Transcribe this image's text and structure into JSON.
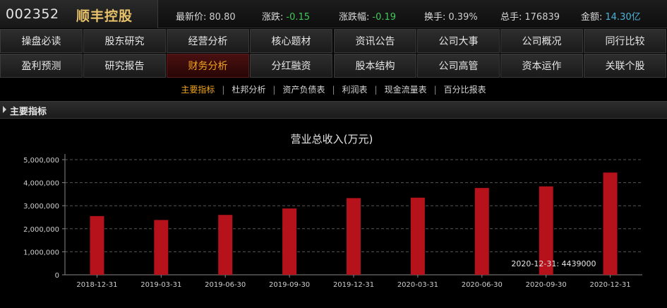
{
  "header": {
    "code": "002352",
    "name": "顺丰控股",
    "quotes": [
      {
        "label": "最新价:",
        "value": "80.80",
        "color": "#cfcfcf"
      },
      {
        "label": "涨跌:",
        "value": "-0.15",
        "color": "#41c85a"
      },
      {
        "label": "涨跌幅:",
        "value": "-0.19",
        "color": "#41c85a"
      },
      {
        "label": "换手:",
        "value": "0.39%",
        "color": "#cfcfcf"
      },
      {
        "label": "总手:",
        "value": "176839",
        "color": "#cfcfcf"
      },
      {
        "label": "金额:",
        "value": "14.30亿",
        "color": "#4fb3d9"
      }
    ]
  },
  "nav": {
    "row1": [
      "操盘必读",
      "股东研究",
      "经营分析",
      "核心题材",
      "资讯公告",
      "公司大事",
      "公司概况",
      "同行比较"
    ],
    "row2": [
      "盈利预测",
      "研究报告",
      "财务分析",
      "分红融资",
      "股本结构",
      "公司高管",
      "资本运作",
      "关联个股"
    ],
    "active": "财务分析"
  },
  "subnav": {
    "items": [
      "主要指标",
      "杜邦分析",
      "资产负债表",
      "利润表",
      "现金流量表",
      "百分比报表"
    ],
    "active": "主要指标"
  },
  "section": {
    "title": "主要指标"
  },
  "colors": {
    "bar": "#b5121b",
    "accent": "#f2a51a",
    "down": "#41c85a"
  },
  "chart_data": {
    "type": "bar",
    "title": "营业总收入(万元)",
    "categories": [
      "2018-12-31",
      "2019-03-31",
      "2019-06-30",
      "2019-09-30",
      "2019-12-31",
      "2020-03-31",
      "2020-06-30",
      "2020-09-30",
      "2020-12-31"
    ],
    "values": [
      2550000,
      2380000,
      2600000,
      2880000,
      3330000,
      3350000,
      3770000,
      3840000,
      4439000
    ],
    "ylim": [
      0,
      5000000
    ],
    "yticks": [
      0,
      1000000,
      2000000,
      3000000,
      4000000,
      5000000
    ],
    "ytick_labels": [
      "0",
      "1,000,000",
      "2,000,000",
      "3,000,000",
      "4,000,000",
      "5,000,000"
    ],
    "grid": true,
    "tooltip": "2020-12-31: 4439000"
  }
}
